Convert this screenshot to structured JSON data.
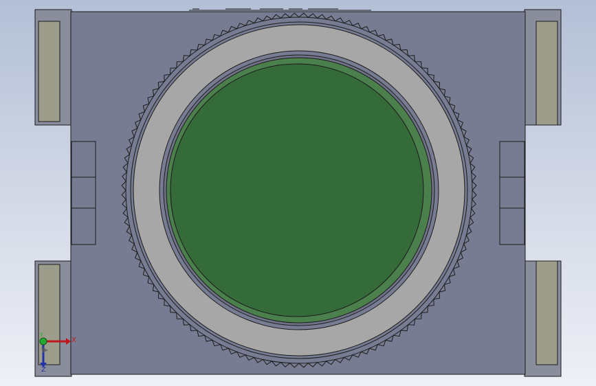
{
  "viewport": {
    "background_top": "#b3bfd6",
    "background_bottom": "#eef0f6"
  },
  "model": {
    "body_color": "#787c93",
    "side_block_color": "#8a8e9c",
    "plate_color": "#9d9d8b",
    "ring_color": "#a7a7a7",
    "ring_edge_color": "#6f7287",
    "lens_color": "#356a39",
    "lens_rim_color": "#4b7f4b",
    "edge_color": "#1a1a1a"
  },
  "triad": {
    "x_label": "X",
    "y_label": "Y",
    "z_label": "Z",
    "x_color": "#c0161c",
    "y_color": "#22aa33",
    "z_color": "#2233aa"
  }
}
